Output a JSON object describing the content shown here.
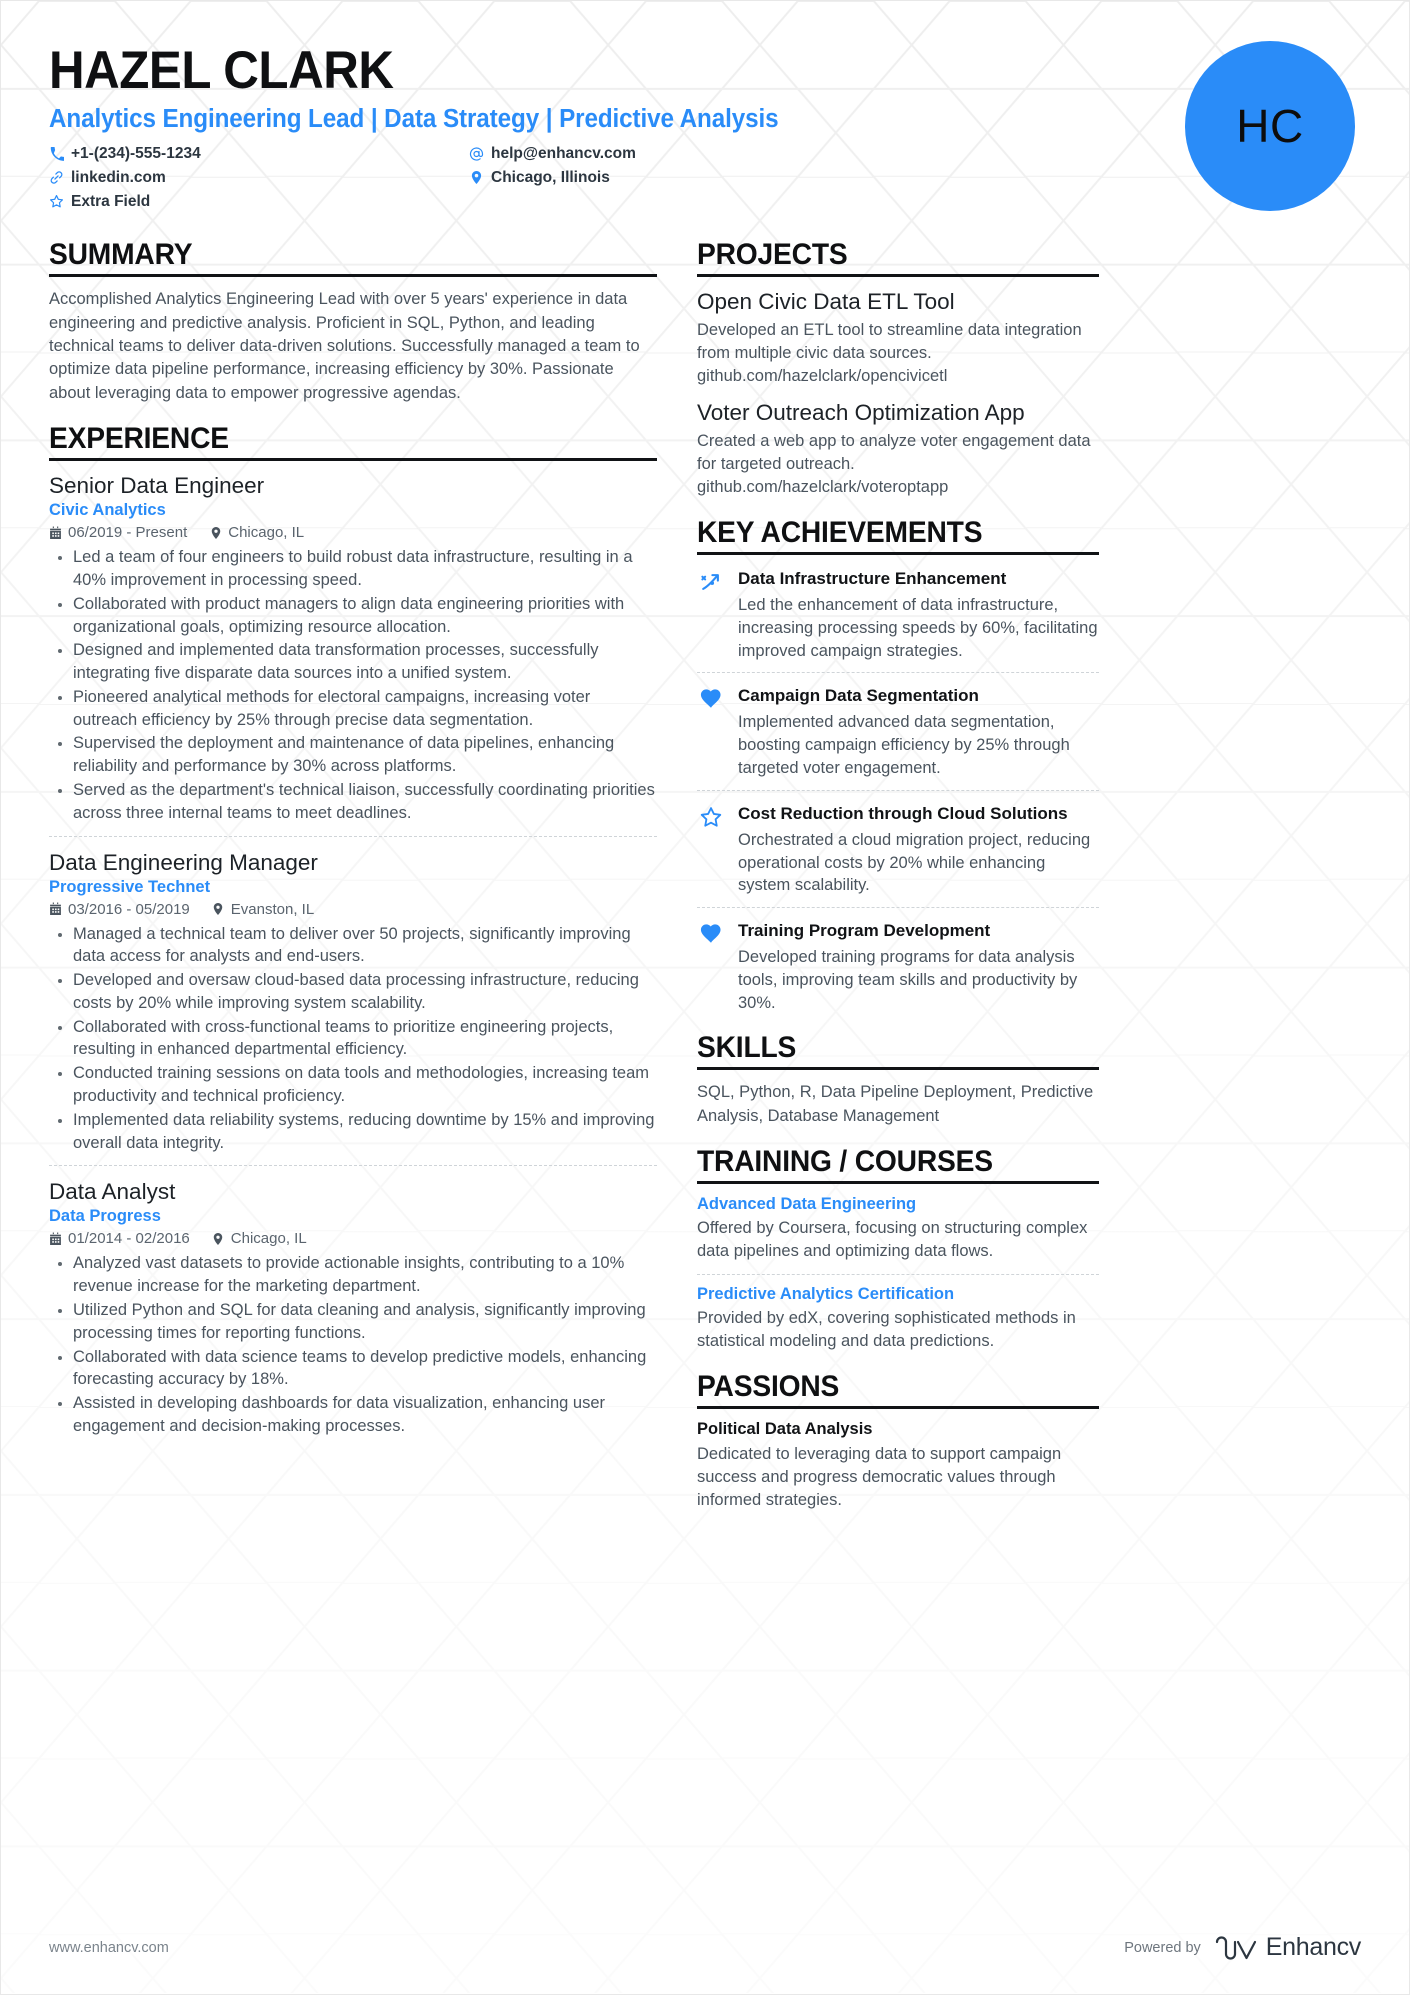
{
  "theme": {
    "accent": "#2a8cf8",
    "heading": "#0f1012",
    "body_text": "#4a545e",
    "rule": "#111316"
  },
  "header": {
    "full_name": "HAZEL CLARK",
    "headline": "Analytics Engineering Lead | Data Strategy | Predictive Analysis",
    "avatar_initials": "HC",
    "contacts": [
      {
        "icon": "phone-icon",
        "text": "+1-(234)-555-1234"
      },
      {
        "icon": "at-icon",
        "text": "help@enhancv.com"
      },
      {
        "icon": "link-icon",
        "text": "linkedin.com"
      },
      {
        "icon": "location-pin-icon",
        "text": "Chicago, Illinois"
      },
      {
        "icon": "star-outline-icon",
        "text": "Extra Field"
      }
    ]
  },
  "summary": {
    "title": "SUMMARY",
    "text": "Accomplished Analytics Engineering Lead with over 5 years' experience in data engineering and predictive analysis. Proficient in SQL, Python, and leading technical teams to deliver data-driven solutions. Successfully managed a team to optimize data pipeline performance, increasing efficiency by 30%. Passionate about leveraging data to empower progressive agendas."
  },
  "experience": {
    "title": "EXPERIENCE",
    "entries": [
      {
        "role": "Senior Data Engineer",
        "company": "Civic Analytics",
        "dates": "06/2019 - Present",
        "location": "Chicago, IL",
        "bullets": [
          "Led a team of four engineers to build robust data infrastructure, resulting in a 40% improvement in processing speed.",
          "Collaborated with product managers to align data engineering priorities with organizational goals, optimizing resource allocation.",
          "Designed and implemented data transformation processes, successfully integrating five disparate data sources into a unified system.",
          "Pioneered analytical methods for electoral campaigns, increasing voter outreach efficiency by 25% through precise data segmentation.",
          "Supervised the deployment and maintenance of data pipelines, enhancing reliability and performance by 30% across platforms.",
          "Served as the department's technical liaison, successfully coordinating priorities across three internal teams to meet deadlines."
        ]
      },
      {
        "role": "Data Engineering Manager",
        "company": "Progressive Technet",
        "dates": "03/2016 - 05/2019",
        "location": "Evanston, IL",
        "bullets": [
          "Managed a technical team to deliver over 50 projects, significantly improving data access for analysts and end-users.",
          "Developed and oversaw cloud-based data processing infrastructure, reducing costs by 20% while improving system scalability.",
          "Collaborated with cross-functional teams to prioritize engineering projects, resulting in enhanced departmental efficiency.",
          "Conducted training sessions on data tools and methodologies, increasing team productivity and technical proficiency.",
          "Implemented data reliability systems, reducing downtime by 15% and improving overall data integrity."
        ]
      },
      {
        "role": "Data Analyst",
        "company": "Data Progress",
        "dates": "01/2014 - 02/2016",
        "location": "Chicago, IL",
        "bullets": [
          "Analyzed vast datasets to provide actionable insights, contributing to a 10% revenue increase for the marketing department.",
          "Utilized Python and SQL for data cleaning and analysis, significantly improving processing times for reporting functions.",
          "Collaborated with data science teams to develop predictive models, enhancing forecasting accuracy by 18%.",
          "Assisted in developing dashboards for data visualization, enhancing user engagement and decision-making processes."
        ]
      }
    ]
  },
  "projects": {
    "title": "PROJECTS",
    "entries": [
      {
        "name": "Open Civic Data ETL Tool",
        "description": "Developed an ETL tool to streamline data integration from multiple civic data sources. github.com/hazelclark/opencivicetl"
      },
      {
        "name": "Voter Outreach Optimization App",
        "description": "Created a web app to analyze voter engagement data for targeted outreach. github.com/hazelclark/voteroptapp"
      }
    ]
  },
  "achievements": {
    "title": "KEY ACHIEVEMENTS",
    "entries": [
      {
        "icon": "growth-arrow-icon",
        "name": "Data Infrastructure Enhancement",
        "description": "Led the enhancement of data infrastructure, increasing processing speeds by 60%, facilitating improved campaign strategies."
      },
      {
        "icon": "heart-filled-icon",
        "name": "Campaign Data Segmentation",
        "description": "Implemented advanced data segmentation, boosting campaign efficiency by 25% through targeted voter engagement."
      },
      {
        "icon": "star-outline-icon",
        "name": "Cost Reduction through Cloud Solutions",
        "description": "Orchestrated a cloud migration project, reducing operational costs by 20% while enhancing system scalability."
      },
      {
        "icon": "heart-filled-icon",
        "name": "Training Program Development",
        "description": "Developed training programs for data analysis tools, improving team skills and productivity by 30%."
      }
    ]
  },
  "skills": {
    "title": "SKILLS",
    "text": "SQL, Python, R, Data Pipeline Deployment, Predictive Analysis, Database Management"
  },
  "training": {
    "title": "TRAINING / COURSES",
    "entries": [
      {
        "name": "Advanced Data Engineering",
        "description": "Offered by Coursera, focusing on structuring complex data pipelines and optimizing data flows."
      },
      {
        "name": "Predictive Analytics Certification",
        "description": "Provided by edX, covering sophisticated methods in statistical modeling and data predictions."
      }
    ]
  },
  "passions": {
    "title": "PASSIONS",
    "entries": [
      {
        "name": "Political Data Analysis",
        "description": "Dedicated to leveraging data to support campaign success and progress democratic values through informed strategies."
      }
    ]
  },
  "footer": {
    "url": "www.enhancv.com",
    "powered_by": "Powered by",
    "brand": "Enhancv"
  }
}
